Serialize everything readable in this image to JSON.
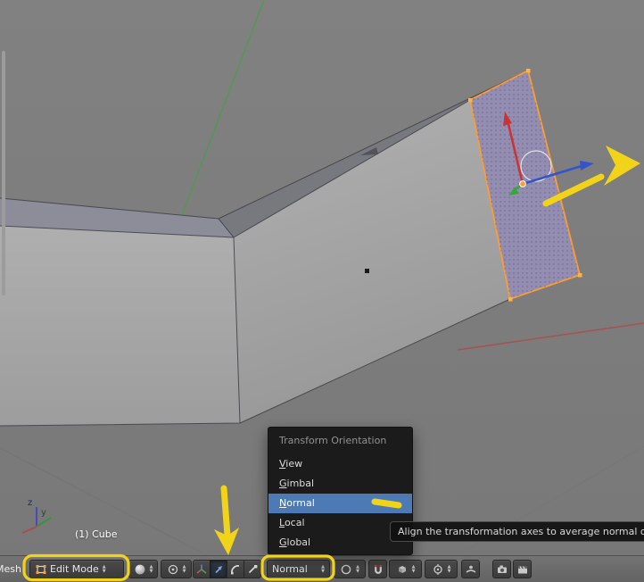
{
  "viewport": {
    "object_info": "(1) Cube",
    "axis_labels": {
      "z": "z",
      "y": "y"
    }
  },
  "menu": {
    "title": "Transform Orientation",
    "highlighted_item": "Normal",
    "items": [
      {
        "key": "V",
        "rest": "iew"
      },
      {
        "key": "G",
        "rest": "imbal"
      },
      {
        "key": "N",
        "rest": "ormal"
      },
      {
        "key": "L",
        "rest": "ocal"
      },
      {
        "key": "G",
        "rest": "lobal"
      }
    ]
  },
  "tooltip": {
    "text": "Align the transformation axes to average normal of se"
  },
  "header": {
    "mesh_menu": "Mesh",
    "mode_selector": "Edit Mode",
    "orientation_selector": "Normal"
  },
  "icons": {
    "combo_up": "▲",
    "combo_down": "▼",
    "editmode_cube": "white cube outline with orange vertex dots",
    "viewport_shading_sphere": "shaded white sphere",
    "pivot_point": "circle with center dot",
    "manipulator_axis": "rgb 3-axis star",
    "translate_manipulator": "blue diagonal arrow",
    "rotate_manipulator": "arc with handle",
    "scale_manipulator": "diagonal line with square",
    "proportional_editing": "gray circle outline",
    "snap_magnet": "horseshoe magnet",
    "snap_element_cube": "small isometric cube",
    "snap_target": "crosshair circle",
    "snap_project": "dot over surface",
    "opengl_render_camera": "photo camera",
    "opengl_render_clapper": "clapperboard"
  },
  "colors": {
    "selection_orange": "#ff9d2e",
    "menu_highlight": "#4d7ab5",
    "annotation_yellow": "#f1d319",
    "axis_red": "#b04a4a",
    "axis_green": "#3f8f3f",
    "axis_blue": "#4949b8"
  }
}
